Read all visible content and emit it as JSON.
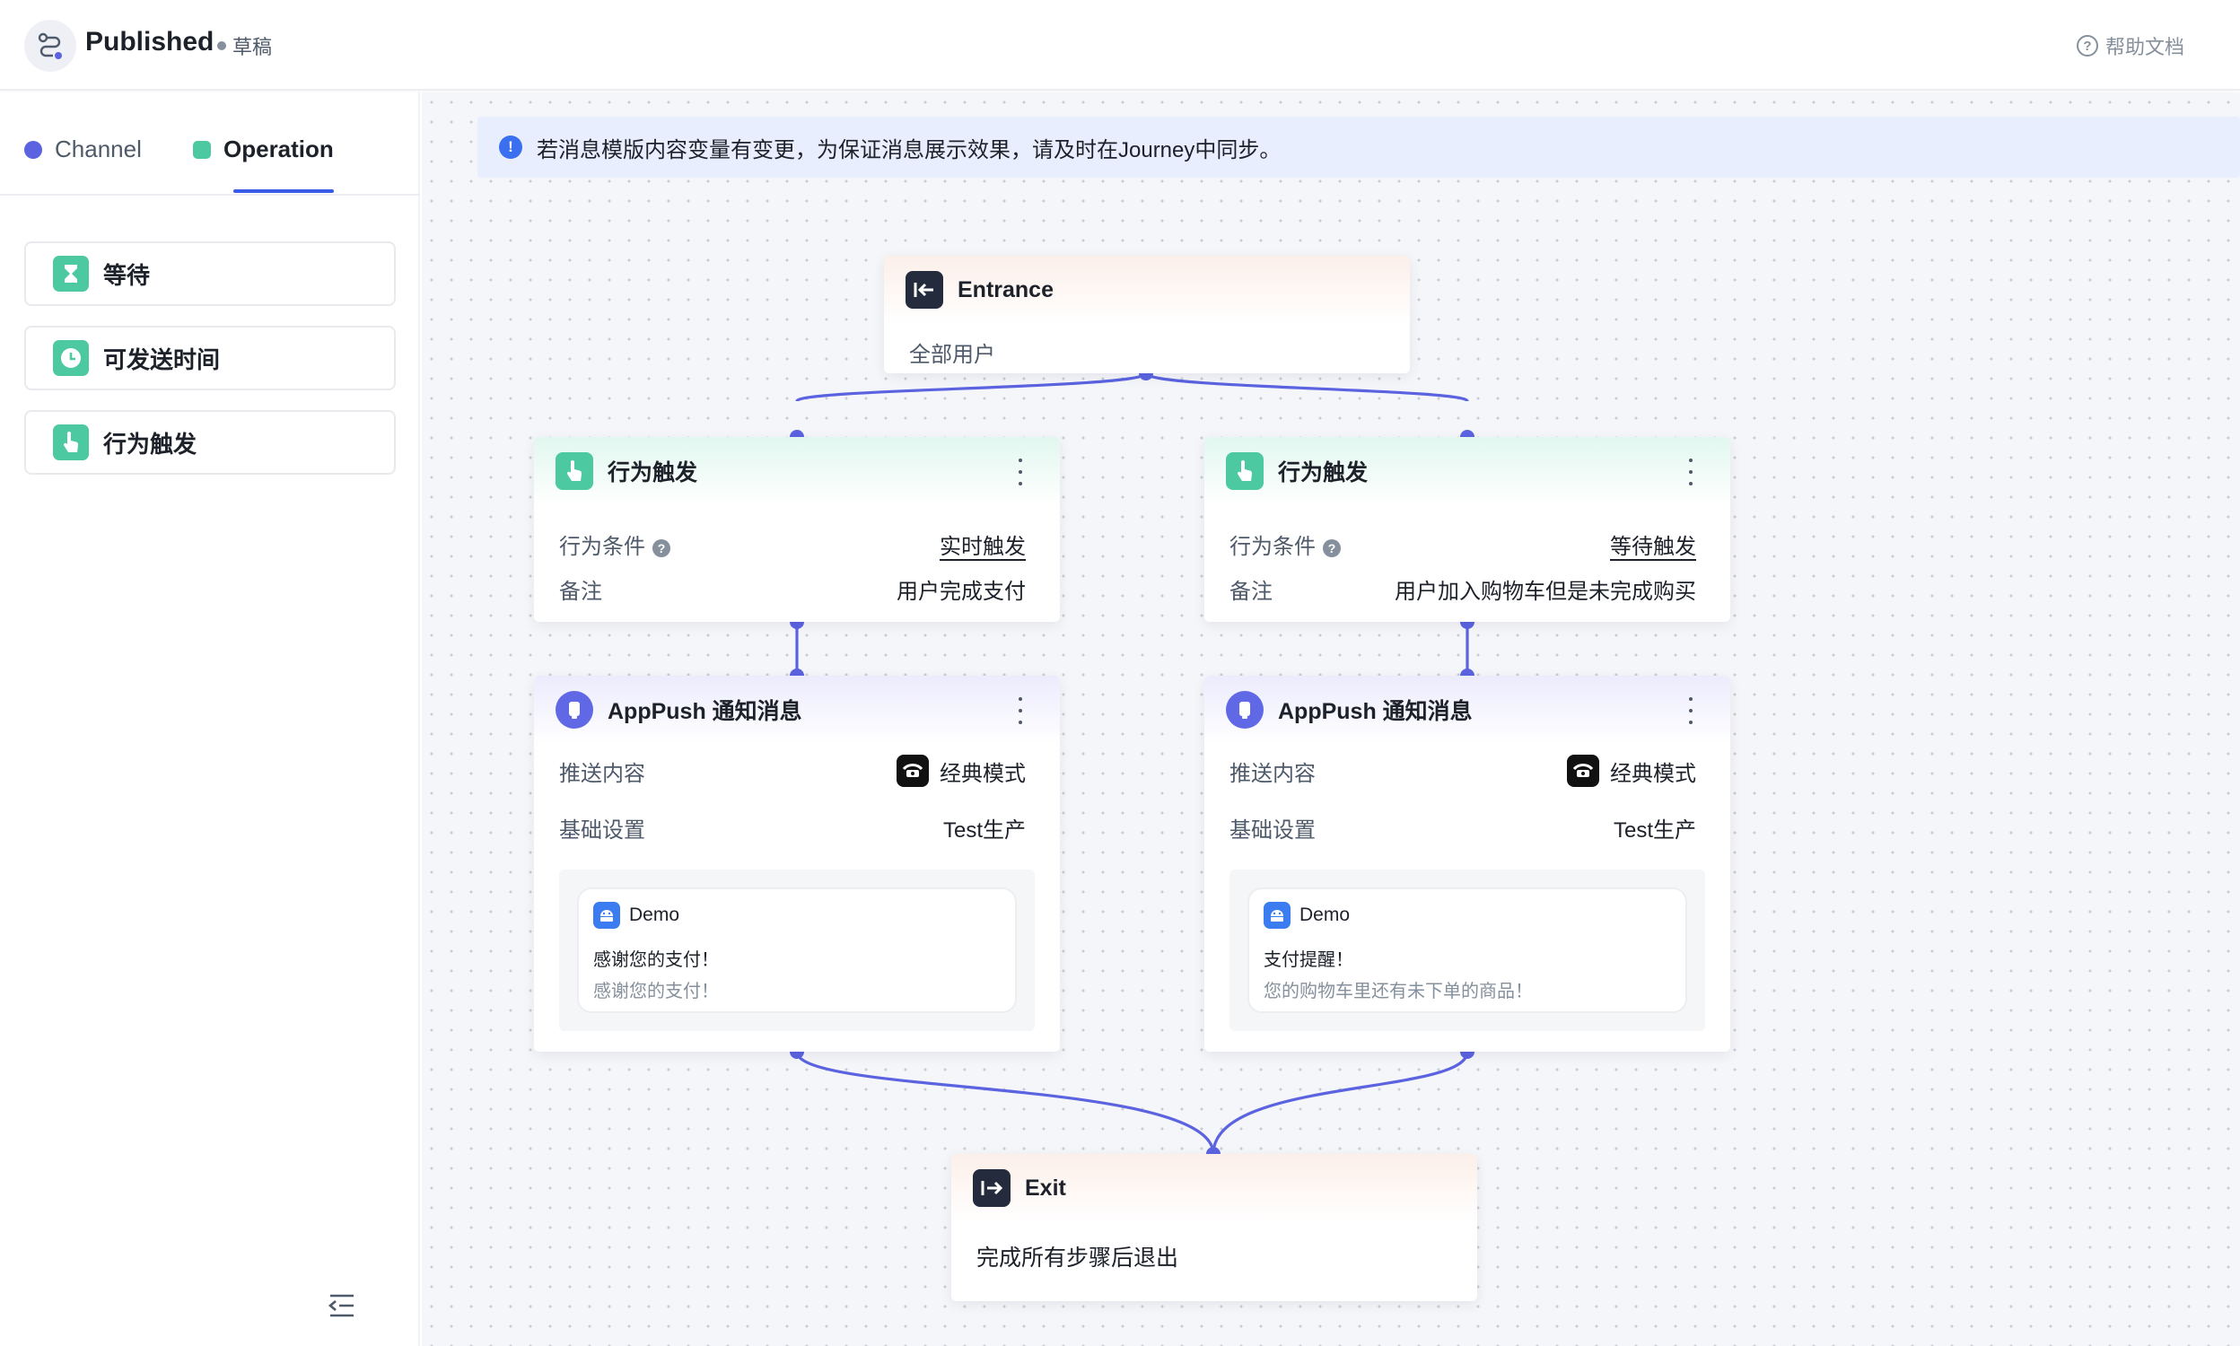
{
  "header": {
    "title": "Published",
    "status": "草稿",
    "help_label": "帮助文档"
  },
  "sidebar": {
    "tabs": [
      {
        "label": "Channel",
        "active": false,
        "color": "#5b63e0"
      },
      {
        "label": "Operation",
        "active": true,
        "color": "#4cc9a0"
      }
    ],
    "items": [
      {
        "label": "等待",
        "icon": "hourglass-icon"
      },
      {
        "label": "可发送时间",
        "icon": "clock-icon"
      },
      {
        "label": "行为触发",
        "icon": "pointer-hand-icon"
      }
    ]
  },
  "canvas": {
    "notice": "若消息模版内容变量有变更，为保证消息展示效果，请及时在Journey中同步。",
    "entrance": {
      "title": "Entrance",
      "desc": "全部用户"
    },
    "triggers": [
      {
        "title": "行为触发",
        "cond_label": "行为条件",
        "cond_value": "实时触发",
        "note_label": "备注",
        "note_value": "用户完成支付"
      },
      {
        "title": "行为触发",
        "cond_label": "行为条件",
        "cond_value": "等待触发",
        "note_label": "备注",
        "note_value": "用户加入购物车但是未完成购买"
      }
    ],
    "pushes": [
      {
        "title": "AppPush 通知消息",
        "content_label": "推送内容",
        "mode": "经典模式",
        "settings_label": "基础设置",
        "settings_value": "Test生产",
        "preview": {
          "app": "Demo",
          "title": "感谢您的支付！",
          "body": "感谢您的支付！"
        }
      },
      {
        "title": "AppPush 通知消息",
        "content_label": "推送内容",
        "mode": "经典模式",
        "settings_label": "基础设置",
        "settings_value": "Test生产",
        "preview": {
          "app": "Demo",
          "title": "支付提醒！",
          "body": "您的购物车里还有未下单的商品！"
        }
      }
    ],
    "exit": {
      "title": "Exit",
      "desc": "完成所有步骤后退出"
    }
  },
  "colors": {
    "accent": "#3a5ae8",
    "connector": "#5b63e0",
    "operation": "#4cc9a0"
  }
}
